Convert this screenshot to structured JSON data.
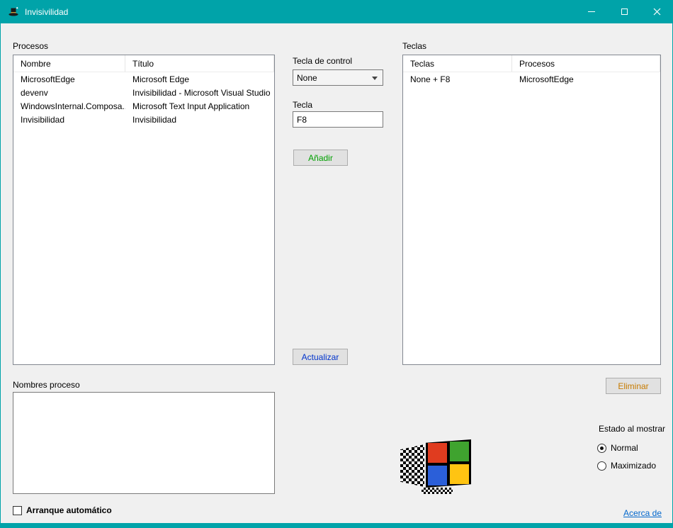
{
  "window": {
    "title": "Invisivilidad"
  },
  "colors": {
    "titlebar": "#00a3a9",
    "anadir_text": "#00a000",
    "actualizar_text": "#0033cc",
    "eliminar_text": "#c77b00",
    "link": "#0066cc"
  },
  "icons": {
    "app": "magician-hat-icon",
    "combo": "chevron-down-icon",
    "caption": [
      "minimize-icon",
      "maximize-icon",
      "close-icon"
    ],
    "footer": "windows-95-logo"
  },
  "procesos": {
    "label": "Procesos",
    "columns": [
      "Nombre",
      "Título"
    ],
    "rows": [
      {
        "nombre": "MicrosoftEdge",
        "titulo": "Microsoft Edge"
      },
      {
        "nombre": "devenv",
        "titulo": "Invisibilidad - Microsoft Visual Studio"
      },
      {
        "nombre": "WindowsInternal.Composa...",
        "titulo": "Microsoft Text Input Application"
      },
      {
        "nombre": "Invisibilidad",
        "titulo": "Invisibilidad"
      }
    ]
  },
  "controls": {
    "tecla_control_label": "Tecla de control",
    "tecla_control_value": "None",
    "tecla_label": "Tecla",
    "tecla_value": "F8",
    "anadir": "Añadir",
    "actualizar": "Actualizar",
    "eliminar": "Eliminar"
  },
  "teclas": {
    "label": "Teclas",
    "columns": [
      "Teclas",
      "Procesos"
    ],
    "rows": [
      {
        "teclas": "None + F8",
        "procesos": "MicrosoftEdge"
      }
    ]
  },
  "nombres_proceso_label": "Nombres proceso",
  "estado": {
    "label": "Estado al mostrar",
    "options": [
      "Normal",
      "Maximizado"
    ],
    "selected": "Normal"
  },
  "arranque_label": "Arranque automático",
  "acerca_label": "Acerca de"
}
